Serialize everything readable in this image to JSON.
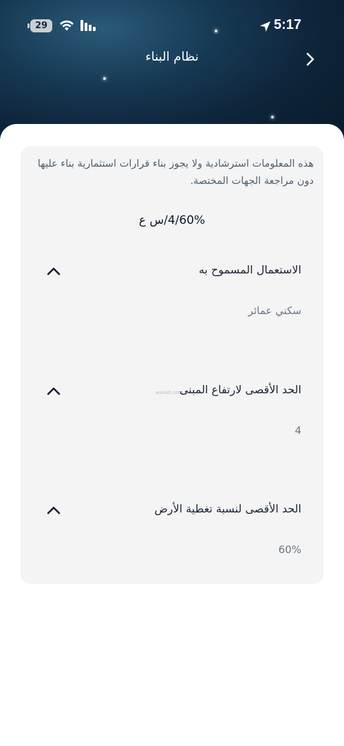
{
  "status_bar": {
    "battery": "29",
    "time": "5:17"
  },
  "header": {
    "title": "نظام البناء",
    "back_icon": "chevron-right-icon"
  },
  "disclaimer": "هذه المعلومات استرشادية ولا يجوز بناء قرارات استثمارية بناء عليها دون مراجعة الجهات المختصة.",
  "summary": "4/60%/س ع",
  "sections": [
    {
      "title": "الاستعمال المسموح به",
      "value": "سكني عمائر",
      "icon": "chevron-up-icon"
    },
    {
      "title": "الحد الأقصى لارتفاع المبنى",
      "value": "4",
      "icon": "chevron-up-icon"
    },
    {
      "title": "الحد الأقصى لنسبة تغطية الأرض",
      "value": "60%",
      "icon": "chevron-up-icon"
    }
  ],
  "watermark": "wasalt.com",
  "colors": {
    "header_dark": "#0d2338",
    "card_bg": "#f4f4f4",
    "title_text": "#1a2434",
    "muted_text": "#6b7785"
  }
}
